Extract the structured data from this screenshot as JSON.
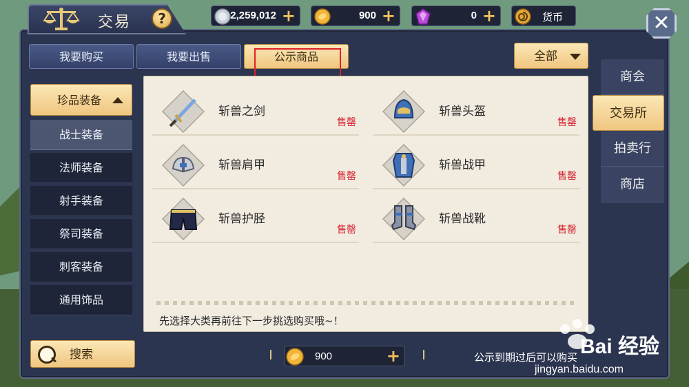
{
  "title": "交易",
  "help_label": "?",
  "currencies": {
    "silver": {
      "value": "2,259,012",
      "icon": "silver-coin-icon"
    },
    "gold": {
      "value": "900",
      "icon": "gold-coin-icon"
    },
    "gem": {
      "value": "0",
      "icon": "gem-icon"
    },
    "currency_label": "货币"
  },
  "plus_label": "+",
  "close_label": "✕",
  "tabs": [
    {
      "label": "我要购买",
      "active": false
    },
    {
      "label": "我要出售",
      "active": false
    },
    {
      "label": "公示商品",
      "active": true
    }
  ],
  "filter": {
    "label": "全部"
  },
  "category": {
    "header": "珍品装备",
    "items": [
      "战士装备",
      "法师装备",
      "射手装备",
      "祭司装备",
      "刺客装备",
      "通用饰品"
    ],
    "selected": "战士装备"
  },
  "items": [
    {
      "name": "斩兽之剑",
      "status": "售罄",
      "icon": "sword-icon"
    },
    {
      "name": "斩兽头盔",
      "status": "售罄",
      "icon": "helmet-icon"
    },
    {
      "name": "斩兽肩甲",
      "status": "售罄",
      "icon": "shoulder-armor-icon"
    },
    {
      "name": "斩兽战甲",
      "status": "售罄",
      "icon": "chest-armor-icon"
    },
    {
      "name": "斩兽护胫",
      "status": "售罄",
      "icon": "leg-guard-icon"
    },
    {
      "name": "斩兽战靴",
      "status": "售罄",
      "icon": "boots-icon"
    }
  ],
  "hint": "先选择大类再前往下一步挑选购买哦~！",
  "side_tabs": [
    {
      "label": "商会",
      "active": false
    },
    {
      "label": "交易所",
      "active": true
    },
    {
      "label": "拍卖行",
      "active": false
    },
    {
      "label": "商店",
      "active": false
    }
  ],
  "search": {
    "label": "搜索"
  },
  "bottom": {
    "gold_value": "900",
    "note": "公示到期过后可以购买"
  },
  "watermark": {
    "line1": "Bai 经验",
    "line2": "jingyan.baidu.com"
  },
  "colors": {
    "accent_gold": "#efc680",
    "panel_dark": "#2c3550",
    "sold_out_red": "#d5202e",
    "highlight_red": "#e0202a"
  }
}
